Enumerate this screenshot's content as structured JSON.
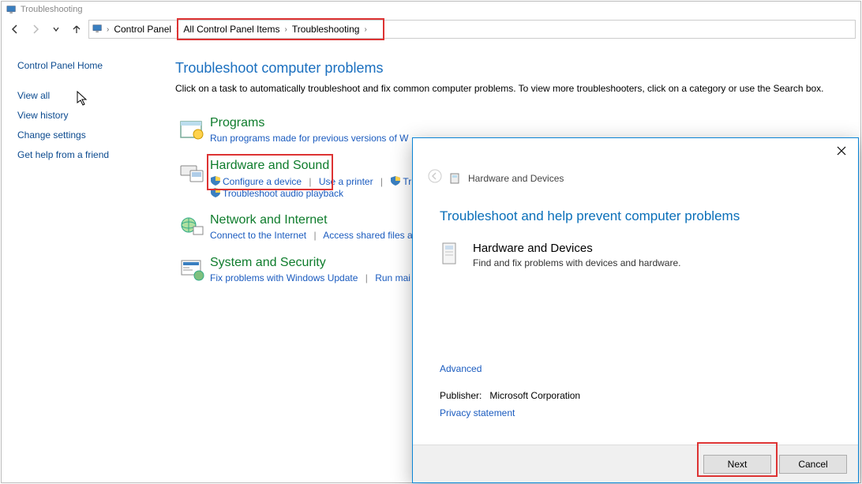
{
  "titlebar": {
    "title": "Troubleshooting"
  },
  "breadcrumb": {
    "segA": "Control Panel",
    "segB": "All Control Panel Items",
    "segC": "Troubleshooting"
  },
  "sidebar": {
    "home": "Control Panel Home",
    "links": [
      "View all",
      "View history",
      "Change settings",
      "Get help from a friend"
    ]
  },
  "main": {
    "heading": "Troubleshoot computer problems",
    "intro": "Click on a task to automatically troubleshoot and fix common computer problems. To view more troubleshooters, click on a category or use the Search box.",
    "categories": {
      "programs": {
        "title": "Programs",
        "link1": "Run programs made for previous versions of W"
      },
      "hardware": {
        "title": "Hardware and Sound",
        "link1": "Configure a device",
        "link2": "Use a printer",
        "link3": "Tr",
        "link4": "Troubleshoot audio playback"
      },
      "network": {
        "title": "Network and Internet",
        "link1": "Connect to the Internet",
        "link2": "Access shared files a"
      },
      "system": {
        "title": "System and Security",
        "link1": "Fix problems with Windows Update",
        "link2": "Run mai"
      }
    }
  },
  "dialog": {
    "breadcrumb": "Hardware and Devices",
    "heading": "Troubleshoot and help prevent computer problems",
    "item_title": "Hardware and Devices",
    "item_desc": "Find and fix problems with devices and hardware.",
    "advanced": "Advanced",
    "publisher_label": "Publisher:",
    "publisher_value": "Microsoft Corporation",
    "privacy": "Privacy statement",
    "next": "Next",
    "cancel": "Cancel"
  }
}
